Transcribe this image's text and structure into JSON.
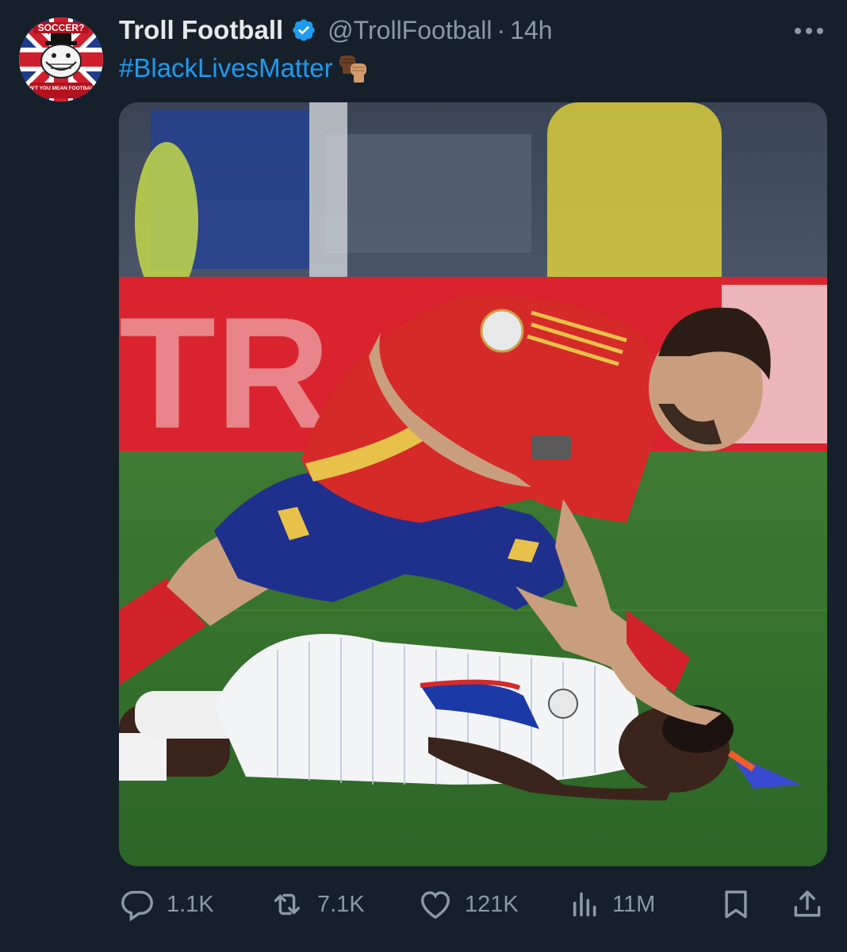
{
  "post": {
    "display_name": "Troll Football",
    "handle": "@TrollFootball",
    "separator": "·",
    "time": "14h",
    "text_hashtag": "#BlackLivesMatter",
    "emoji": "raised-fist-medium-dark-and-medium-light-skin-tones",
    "media_description": "Spain player in red shirt and blue shorts leaning over a France player in white striped kit lying on the pitch",
    "avatar": {
      "top_text": "SOCCER?",
      "bottom_text": "DON'T YOU MEAN FOOTBALL?"
    }
  },
  "actions": {
    "replies": "1.1K",
    "reposts": "7.1K",
    "likes": "121K",
    "views": "11M"
  },
  "icons": {
    "verified": "verified-badge-icon",
    "more": "more-dots-icon",
    "reply": "reply-icon",
    "repost": "repost-icon",
    "like": "heart-icon",
    "views": "views-icon",
    "bookmark": "bookmark-icon",
    "share": "share-icon"
  },
  "colors": {
    "background": "#15202b",
    "text": "#e7e9ea",
    "secondary": "#8b98a5",
    "accent": "#1d9bf0"
  }
}
